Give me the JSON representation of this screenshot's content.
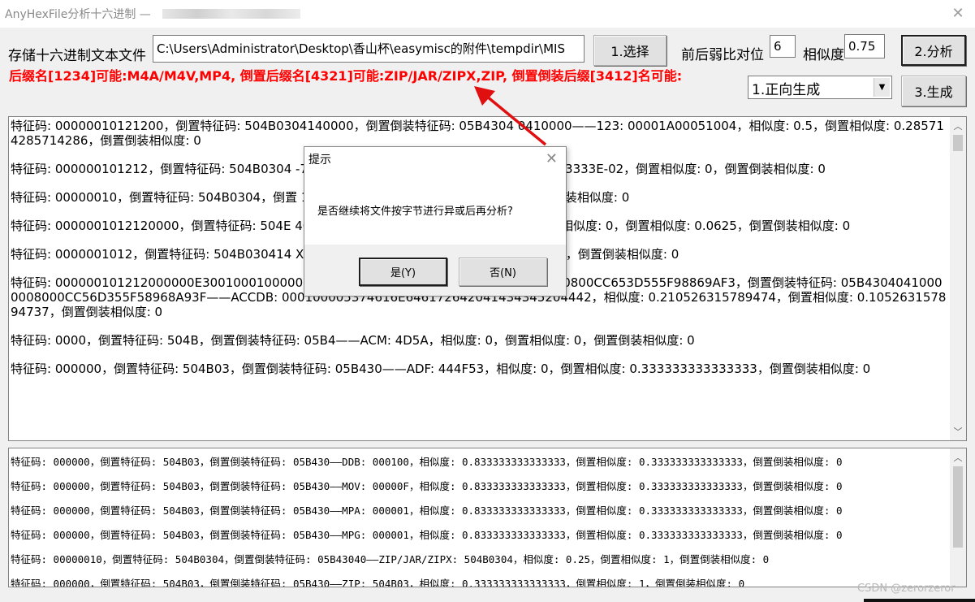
{
  "window": {
    "title": "AnyHexFile分析十六进制 —",
    "close": "✕"
  },
  "toolbar": {
    "file_label": "存储十六进制文本文件",
    "file_path": "C:\\Users\\Administrator\\Desktop\\香山杯\\easymisc的附件\\tempdir\\MIS",
    "select_button": "1.选择",
    "compare_label": "前后弱比对位",
    "compare_value": "6",
    "similarity_label": "相似度",
    "similarity_value": "0.75",
    "analyze_button": "2.分析",
    "mode_selected": "1.正向生成",
    "generate_button": "3.生成"
  },
  "result_line": "后缀名[1234]可能:M4A/M4V,MP4, 倒置后缀名[4321]可能:ZIP/JAR/ZIPX,ZIP, 倒置倒装后缀[3412]名可能:",
  "panel1": {
    "entries": [
      "特征码: 00000010121200，倒置特征码: 504B0304140000，倒置倒装特征码: 05B4304 0410000——123: 00001A00051004，相似度: 0.5，倒置相似度: 0.285714285714286，倒置倒装相似度: 0",
      "特征码: 000000101212，倒置特征码: 504B0304                                                                                   -7Z: 377ABCAF271C，相似度: 8.33333333333333E-02，倒置相似度: 0，倒置倒装相似度: 0",
      "特征码: 00000010，倒置特征码: 504B0304，倒置                                                                           1，相似度: 0.375，倒置相似度: 0.125，倒置倒装相似度: 0",
      "特征码: 0000001012120000，倒置特征码: 504E                                                                             4041000000——ABI: 414F4C494E444558，相似度: 0，倒置相似度: 0.0625，倒置倒装相似度: 0",
      "特征码: 0000001012，倒置特征码: 504B030414                                                                             X: 414F4C4442，相似度: 0.1，倒置相似度: 0.2，倒置倒装相似度: 0",
      "特征码: 000000101212000000E30010001000000000060，倒置特征码: 504B0304140000000800CC653D555F98869AF3，倒置倒装特征码: 05B43040410000008000CC56D355F58968A93F——ACCDB: 000100005374616E646172642041434345204442，相似度: 0.210526315789474，倒置相似度: 0.105263157894737，倒置倒装相似度: 0",
      "特征码: 0000，倒置特征码: 504B，倒置倒装特征码: 05B4——ACM: 4D5A，相似度: 0，倒置相似度: 0，倒置倒装相似度: 0",
      "特征码: 000000，倒置特征码: 504B03，倒置倒装特征码: 05B430——ADF: 444F53，相似度: 0，倒置相似度: 0.333333333333333，倒置倒装相似度: 0"
    ]
  },
  "panel2": {
    "entries": [
      "特征码: 000000，倒置特征码: 504B03，倒置倒装特征码: 05B430——DDB: 000100，相似度: 0.833333333333333，倒置相似度: 0.333333333333333，倒置倒装相似度: 0",
      "特征码: 000000，倒置特征码: 504B03，倒置倒装特征码: 05B430——MOV: 00000F，相似度: 0.833333333333333，倒置相似度: 0.333333333333333，倒置倒装相似度: 0",
      "特征码: 000000，倒置特征码: 504B03，倒置倒装特征码: 05B430——MPA: 000001，相似度: 0.833333333333333，倒置相似度: 0.333333333333333，倒置倒装相似度: 0",
      "特征码: 000000，倒置特征码: 504B03，倒置倒装特征码: 05B430——MPG: 000001，相似度: 0.833333333333333，倒置相似度: 0.333333333333333，倒置倒装相似度: 0",
      "特征码: 00000010，倒置特征码: 504B0304，倒置倒装特征码: 05B43040——ZIP/JAR/ZIPX: 504B0304，相似度: 0.25，倒置相似度: 1，倒置倒装相似度: 0",
      "特征码: 000000，倒置特征码: 504B03，倒置倒装特征码: 05B430——ZIP: 504B03，相似度: 0.333333333333333，倒置相似度: 1，倒置倒装相似度: 0"
    ]
  },
  "dialog": {
    "title": "提示",
    "message": "是否继续将文件按字节进行异或后再分析?",
    "yes": "是(Y)",
    "no": "否(N)",
    "close": "✕"
  },
  "watermark": "CSDN @zerorzeror",
  "colors": {
    "result_red": "#ff0000",
    "arrow_red": "#e01010"
  }
}
